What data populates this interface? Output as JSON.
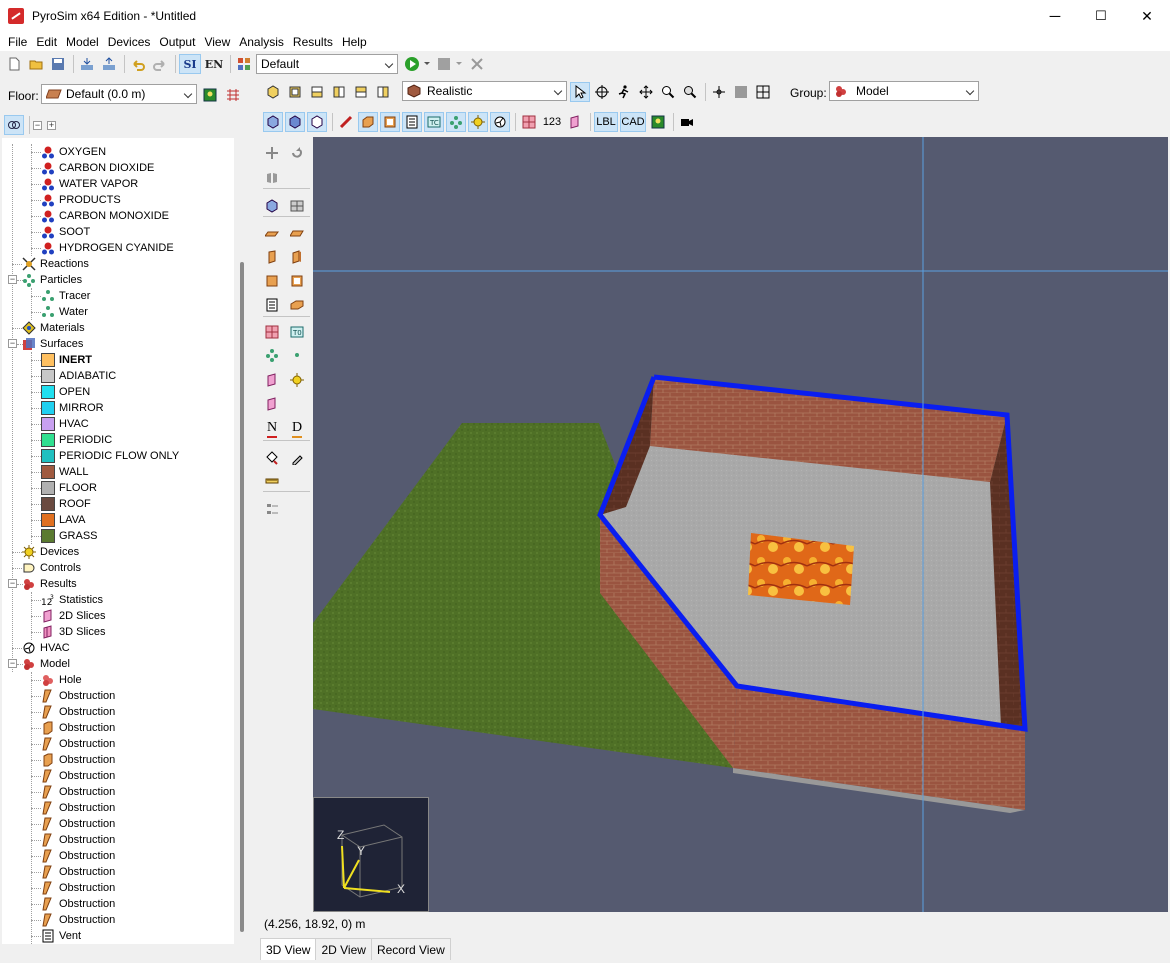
{
  "window": {
    "title": "PyroSim x64 Edition - *Untitled",
    "minimize": "─",
    "maximize": "☐",
    "close": "✕"
  },
  "menu": [
    "File",
    "Edit",
    "Model",
    "Devices",
    "Output",
    "View",
    "Analysis",
    "Results",
    "Help"
  ],
  "toolbar": {
    "units_si": "SI",
    "units_en": "EN",
    "scenario": "Default"
  },
  "floor": {
    "label": "Floor:",
    "value": "Default (0.0 m)"
  },
  "view_toolbar": {
    "render_mode": "Realistic",
    "group_label": "Group:",
    "group_value": "Model",
    "lbl_button": "LBL",
    "cad_button": "CAD",
    "n_button": "N",
    "d_button": "D",
    "stats_button": "123"
  },
  "tree": {
    "species": [
      "OXYGEN",
      "CARBON DIOXIDE",
      "WATER VAPOR",
      "PRODUCTS",
      "CARBON MONOXIDE",
      "SOOT",
      "HYDROGEN CYANIDE"
    ],
    "reactions": "Reactions",
    "particles": "Particles",
    "particle_items": [
      "Tracer",
      "Water"
    ],
    "materials": "Materials",
    "surfaces": "Surfaces",
    "surface_items": [
      {
        "label": "INERT",
        "color": "#ffc060",
        "bold": true
      },
      {
        "label": "ADIABATIC",
        "color": "#c8c8c8"
      },
      {
        "label": "OPEN",
        "color": "#20e0f0"
      },
      {
        "label": "MIRROR",
        "color": "#20d0f0"
      },
      {
        "label": "HVAC",
        "color": "#c8a0f0"
      },
      {
        "label": "PERIODIC",
        "color": "#30e090"
      },
      {
        "label": "PERIODIC FLOW ONLY",
        "color": "#20c0c0"
      },
      {
        "label": "WALL",
        "color": "#a05a40"
      },
      {
        "label": "FLOOR",
        "color": "#b0b0b0"
      },
      {
        "label": "ROOF",
        "color": "#6a4a40"
      },
      {
        "label": "LAVA",
        "color": "#e07020"
      },
      {
        "label": "GRASS",
        "color": "#5a7a30"
      }
    ],
    "devices": "Devices",
    "controls": "Controls",
    "results": "Results",
    "result_items": [
      "Statistics",
      "2D Slices",
      "3D Slices"
    ],
    "hvac": "HVAC",
    "model": "Model",
    "model_items": [
      "Hole",
      "Obstruction",
      "Obstruction",
      "Obstruction",
      "Obstruction",
      "Obstruction",
      "Obstruction",
      "Obstruction",
      "Obstruction",
      "Obstruction",
      "Obstruction",
      "Obstruction",
      "Obstruction",
      "Obstruction",
      "Obstruction",
      "Obstruction",
      "Vent"
    ]
  },
  "axes": {
    "x": "X",
    "y": "Y",
    "z": "Z"
  },
  "status": {
    "coords": "(4.256, 18.92, 0) m"
  },
  "tabs": [
    "3D View",
    "2D View",
    "Record View"
  ],
  "colors": {
    "viewport_bg": "#555a70",
    "grass": "#4f7026",
    "floor": "#a8a8a8",
    "wall": "#8a4a38",
    "outline": "#0a1ef0",
    "crosshair": "#5aa0e0"
  }
}
